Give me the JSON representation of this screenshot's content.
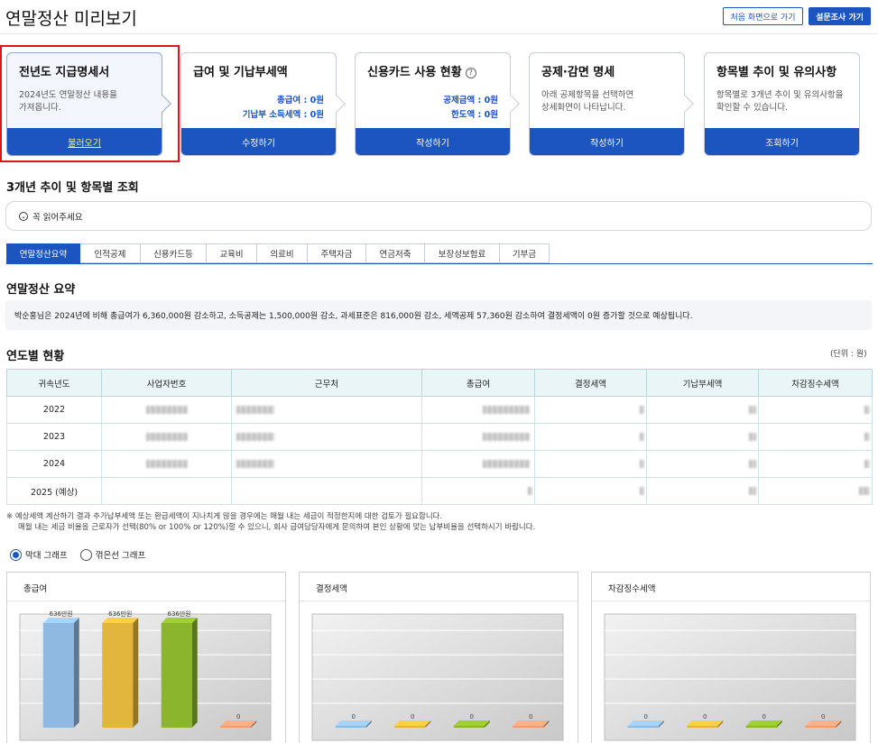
{
  "page": {
    "title": "연말정산 미리보기"
  },
  "header_buttons": {
    "home": "처음 화면으로 가기",
    "survey": "설문조사 가기"
  },
  "steps": [
    {
      "title": "전년도 지급명세서",
      "desc": "2024년도 연말정산 내용을\n가져옵니다.",
      "kv": [],
      "button": "불러오기"
    },
    {
      "title": "급여 및 기납부세액",
      "desc": "",
      "kv": [
        "총급여 : 0원",
        "기납부 소득세액 : 0원"
      ],
      "button": "수정하기"
    },
    {
      "title": "신용카드 사용 현황",
      "desc": "",
      "kv": [
        "공제금액 : 0원",
        "한도액 : 0원"
      ],
      "button": "작성하기",
      "help": "?"
    },
    {
      "title": "공제·감면 명세",
      "desc": "아래 공제항목을 선택하면\n상세화면이 나타납니다.",
      "kv": [],
      "button": "작성하기"
    },
    {
      "title": "항목별 추이 및 유의사항",
      "desc": "항목별로 3개년 추이 및 유의사항을\n확인할 수 있습니다.",
      "kv": [],
      "button": "조회하기"
    }
  ],
  "trend_section": {
    "title": "3개년 추이 및 항목별 조회",
    "notice": "꼭 읽어주세요",
    "notice_icon": "chevron-down-circle-icon"
  },
  "tabs": [
    "연말정산요약",
    "인적공제",
    "신용카드등",
    "교육비",
    "의료비",
    "주택자금",
    "연금저축",
    "보장성보험료",
    "기부금"
  ],
  "summary": {
    "title": "연말정산 요약",
    "text": "박순홍님은 2024년에 비해 총급여가 6,360,000원 감소하고, 소득공제는 1,500,000원 감소, 과세표준은 816,000원 감소, 세액공제 57,360원 감소하여 결정세액이 0원 증가할 것으로 예상됩니다."
  },
  "yearly": {
    "title": "연도별 현황",
    "unit": "(단위 : 원)",
    "headers": [
      "귀속년도",
      "사업자번호",
      "근무처",
      "총급여",
      "결정세액",
      "기납부세액",
      "차감징수세액"
    ],
    "rows": [
      {
        "year": "2022"
      },
      {
        "year": "2023"
      },
      {
        "year": "2024"
      },
      {
        "year": "2025 (예상)"
      }
    ]
  },
  "footnote": {
    "line1": "※ 예상세액 계산하기 결과 추가납부세액 또는 환급세액이 지나치게 많을 경우에는 매월 내는 세금이 적정한지에 대한 검토가 필요합니다.",
    "line2": "매월 내는 세금 비율을 근로자가 선택(80% or 100% or 120%)할 수 있으니, 회사 급여담당자에게 문의하여 본인 상황에 맞는 납부비율을 선택하시기 바랍니다."
  },
  "graph_options": {
    "bar": "막대 그래프",
    "line": "꺾은선 그래프",
    "selected": "bar"
  },
  "chart_data": [
    {
      "type": "bar",
      "title": "총급여",
      "series": [
        {
          "label": "636만원",
          "value": 636,
          "color": "#8fb9e0"
        },
        {
          "label": "636만원",
          "value": 636,
          "color": "#e2b53c"
        },
        {
          "label": "636만원",
          "value": 636,
          "color": "#8bb52c"
        },
        {
          "label": "0",
          "value": 0,
          "color": "#f09a72"
        }
      ],
      "ylim": [
        0,
        636
      ]
    },
    {
      "type": "bar",
      "title": "결정세액",
      "series": [
        {
          "label": "0",
          "value": 0,
          "color": "#8fb9e0"
        },
        {
          "label": "0",
          "value": 0,
          "color": "#e2b53c"
        },
        {
          "label": "0",
          "value": 0,
          "color": "#8bb52c"
        },
        {
          "label": "0",
          "value": 0,
          "color": "#f09a72"
        }
      ]
    },
    {
      "type": "bar",
      "title": "차감징수세액",
      "series": [
        {
          "label": "0",
          "value": 0,
          "color": "#8fb9e0"
        },
        {
          "label": "0",
          "value": 0,
          "color": "#e2b53c"
        },
        {
          "label": "0",
          "value": 0,
          "color": "#8bb52c"
        },
        {
          "label": "0",
          "value": 0,
          "color": "#f09a72"
        }
      ]
    }
  ]
}
